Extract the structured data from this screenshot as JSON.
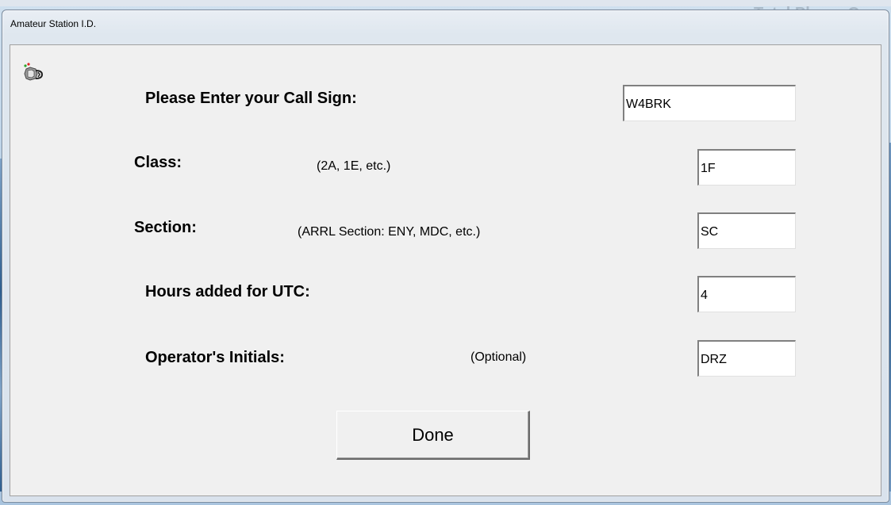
{
  "background": {
    "partial_text": "Total Phone C"
  },
  "window": {
    "title": "Amateur Station I.D."
  },
  "form": {
    "call_sign": {
      "label": "Please Enter your Call Sign:",
      "value": "W4BRK"
    },
    "class": {
      "label": "Class:",
      "hint": "(2A, 1E, etc.)",
      "value": "1F"
    },
    "section": {
      "label": "Section:",
      "hint": "(ARRL Section: ENY, MDC, etc.)",
      "value": "SC"
    },
    "utc_hours": {
      "label": "Hours added for UTC:",
      "value": "4"
    },
    "operator_initials": {
      "label": "Operator's Initials:",
      "hint": "(Optional)",
      "value": "DRZ"
    }
  },
  "buttons": {
    "done": "Done"
  },
  "icons": {
    "app": "radio-key-icon"
  }
}
